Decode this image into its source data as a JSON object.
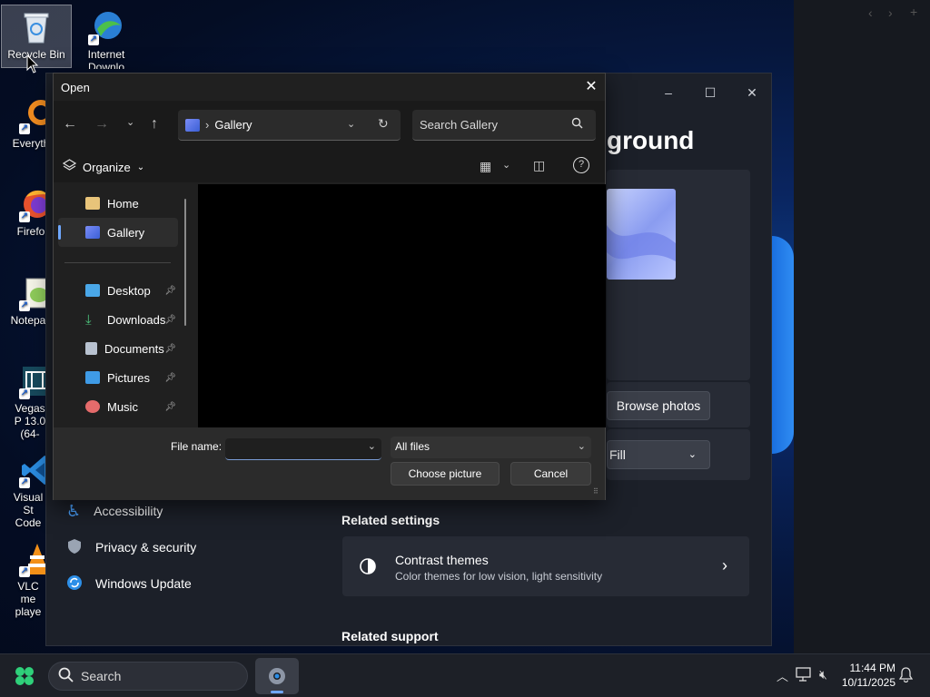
{
  "desktop": {
    "icons": [
      {
        "label": "Recycle Bin"
      },
      {
        "label": "Internet Downlo"
      },
      {
        "label": "Everyth"
      },
      {
        "label": "Firefo"
      },
      {
        "label": "Notepac"
      },
      {
        "label": "Vegas P 13.0 (64-"
      },
      {
        "label": "Visual St Code"
      },
      {
        "label": "VLC me playe"
      }
    ]
  },
  "right_strip": {
    "icons": [
      "chevron-left-icon",
      "chevron-right-icon",
      "plus-icon"
    ]
  },
  "settings": {
    "heading": "ground",
    "browse_photos": "Browse photos",
    "fit_value": "Fill",
    "nav": [
      {
        "label": "Accessibility"
      },
      {
        "label": "Privacy & security"
      },
      {
        "label": "Windows Update"
      }
    ],
    "related_settings": "Related settings",
    "contrast": {
      "title": "Contrast themes",
      "subtitle": "Color themes for low vision, light sensitivity"
    },
    "related_support": "Related support"
  },
  "dialog": {
    "title": "Open",
    "address": "Gallery",
    "search_placeholder": "Search Gallery",
    "organize": "Organize",
    "sidebar": [
      {
        "label": "Home"
      },
      {
        "label": "Gallery"
      },
      {
        "label": "Desktop"
      },
      {
        "label": "Downloads"
      },
      {
        "label": "Documents"
      },
      {
        "label": "Pictures"
      },
      {
        "label": "Music"
      }
    ],
    "file_name_label": "File name:",
    "file_name_value": "",
    "file_type": "All files",
    "choose": "Choose picture",
    "cancel": "Cancel"
  },
  "taskbar": {
    "search": "Search",
    "time": "11:44 PM",
    "date": "10/11/2025"
  }
}
